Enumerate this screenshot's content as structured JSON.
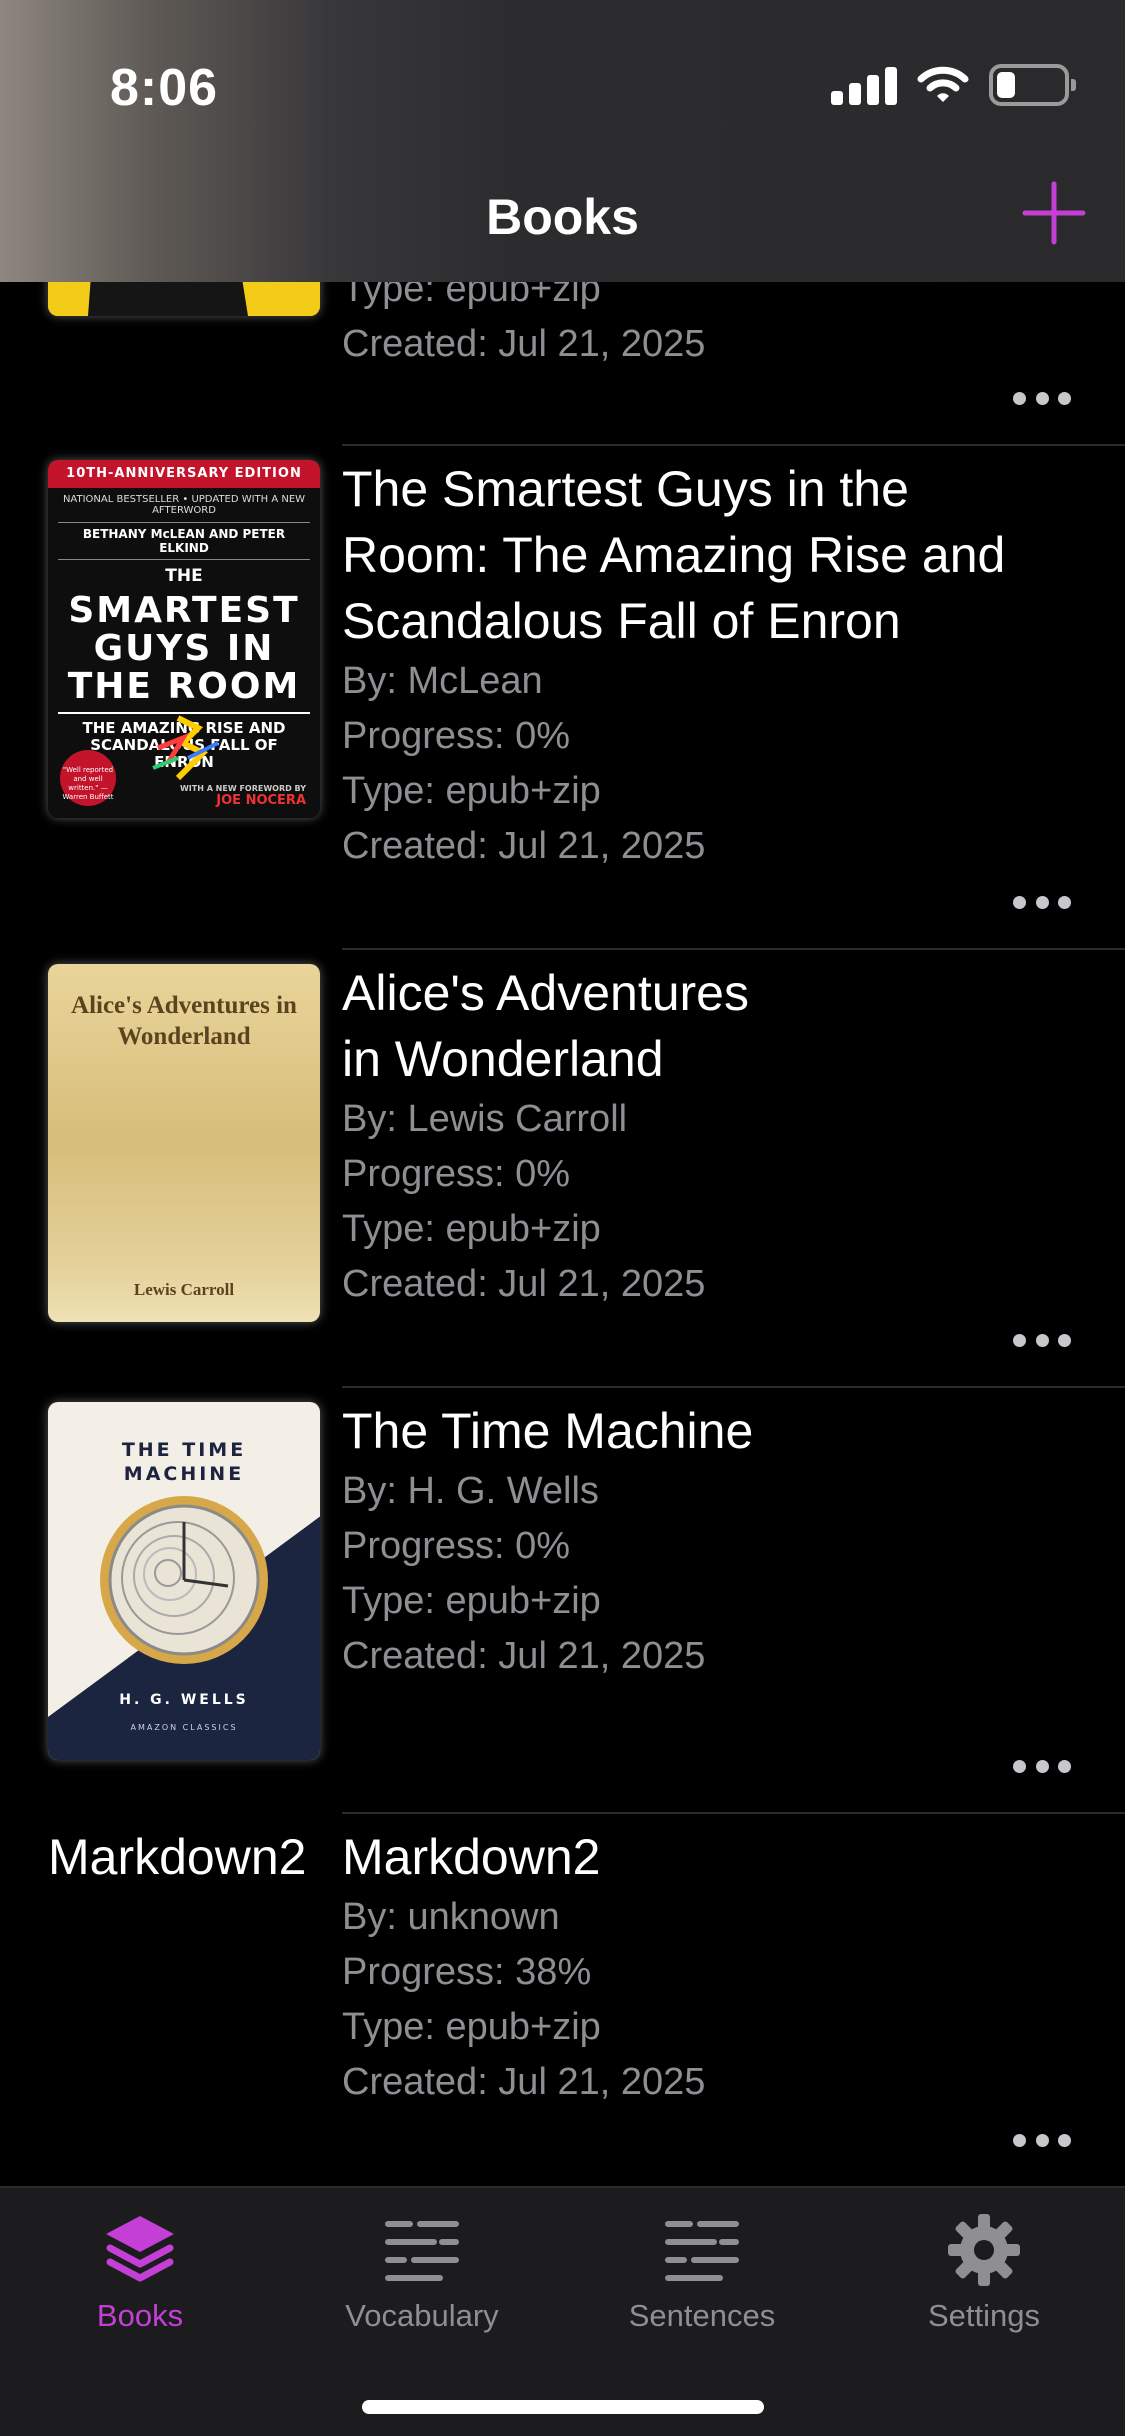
{
  "status_bar": {
    "time": "8:06"
  },
  "nav": {
    "title": "Books"
  },
  "books": [
    {
      "cover_kind": "yellow-partial",
      "type": "Type: epub+zip",
      "created": "Created: Jul 21, 2025"
    },
    {
      "title": "The Smartest Guys in the Room: The Amazing Rise and Scandalous Fall of Enron",
      "title_lines": [
        "The Smartest Guys in the",
        "Room: The Amazing Rise and",
        "Scandalous Fall of Enron"
      ],
      "author": "By: McLean",
      "progress": "Progress: 0%",
      "type": "Type: epub+zip",
      "created": "Created: Jul 21, 2025",
      "cover": {
        "band": "10TH-ANNIVERSARY EDITION",
        "tagline": "NATIONAL BESTSELLER • UPDATED WITH A NEW AFTERWORD",
        "authors": "BETHANY McLEAN AND PETER ELKIND",
        "the": "THE",
        "big": "SMARTEST GUYS IN THE ROOM",
        "sub": "THE AMAZING RISE AND SCANDALOUS FALL OF ENRON",
        "badge": "\"Well reported and well written.\" —Warren Buffett",
        "foreword": "WITH A NEW FOREWORD BY",
        "foreword_by": "JOE NOCERA"
      }
    },
    {
      "title_lines": [
        "Alice's Adventures",
        "in Wonderland"
      ],
      "author": "By: Lewis Carroll",
      "progress": "Progress: 0%",
      "type": "Type: epub+zip",
      "created": "Created: Jul 21, 2025",
      "cover": {
        "title": "Alice's Adventures in Wonderland",
        "author": "Lewis Carroll"
      }
    },
    {
      "title_lines": [
        "The Time Machine"
      ],
      "author": "By: H. G. Wells",
      "progress": "Progress: 0%",
      "type": "Type: epub+zip",
      "created": "Created: Jul 21, 2025",
      "cover": {
        "title": "THE TIME MACHINE",
        "author": "H. G. WELLS",
        "publisher": "AMAZON CLASSICS"
      }
    },
    {
      "cover_text": "Markdown2",
      "title_lines": [
        "Markdown2"
      ],
      "author": "By: unknown",
      "progress": "Progress: 38%",
      "type": "Type: epub+zip",
      "created": "Created: Jul 21, 2025"
    }
  ],
  "tabs": [
    {
      "label": "Books",
      "icon": "stack-icon",
      "active": true
    },
    {
      "label": "Vocabulary",
      "icon": "text-lines-icon",
      "active": false
    },
    {
      "label": "Sentences",
      "icon": "text-lines-icon",
      "active": false
    },
    {
      "label": "Settings",
      "icon": "gear-icon",
      "active": false
    }
  ],
  "colors": {
    "accent": "#C33FD6",
    "background": "#000000",
    "secondary_text": "#8E8E93"
  }
}
